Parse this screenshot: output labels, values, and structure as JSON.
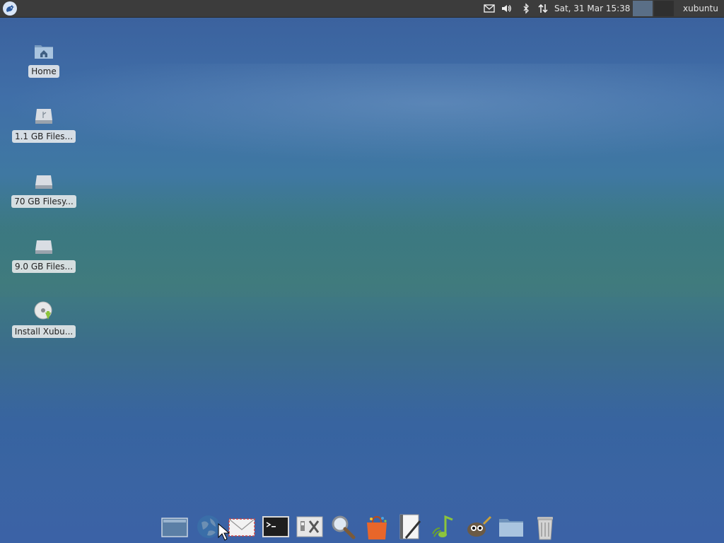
{
  "top_panel": {
    "clock": "Sat, 31 Mar  15:38",
    "user": "xubuntu",
    "tray_icons": [
      "mail-icon",
      "volume-icon",
      "bluetooth-icon",
      "network-icon"
    ]
  },
  "desktop_icons": [
    {
      "label": "Home",
      "icon": "home-folder-icon"
    },
    {
      "label": "1.1 GB Files...",
      "icon": "drive-icon"
    },
    {
      "label": "70 GB Filesy...",
      "icon": "drive-icon"
    },
    {
      "label": "9.0 GB Files...",
      "icon": "drive-icon"
    },
    {
      "label": "Install Xubu...",
      "icon": "installer-disc-icon"
    }
  ],
  "dock": {
    "items": [
      "show-desktop-icon",
      "web-browser-icon",
      "mail-client-icon",
      "terminal-icon",
      "settings-icon",
      "search-icon",
      "software-center-icon",
      "text-editor-icon",
      "music-player-icon",
      "image-editor-icon",
      "file-manager-icon",
      "trash-icon"
    ]
  },
  "colors": {
    "panel": "#3c3c3c",
    "desktop_top": "#3a5f9c",
    "desktop_mid": "#3f7c80",
    "desktop_bottom": "#3b62a6"
  }
}
